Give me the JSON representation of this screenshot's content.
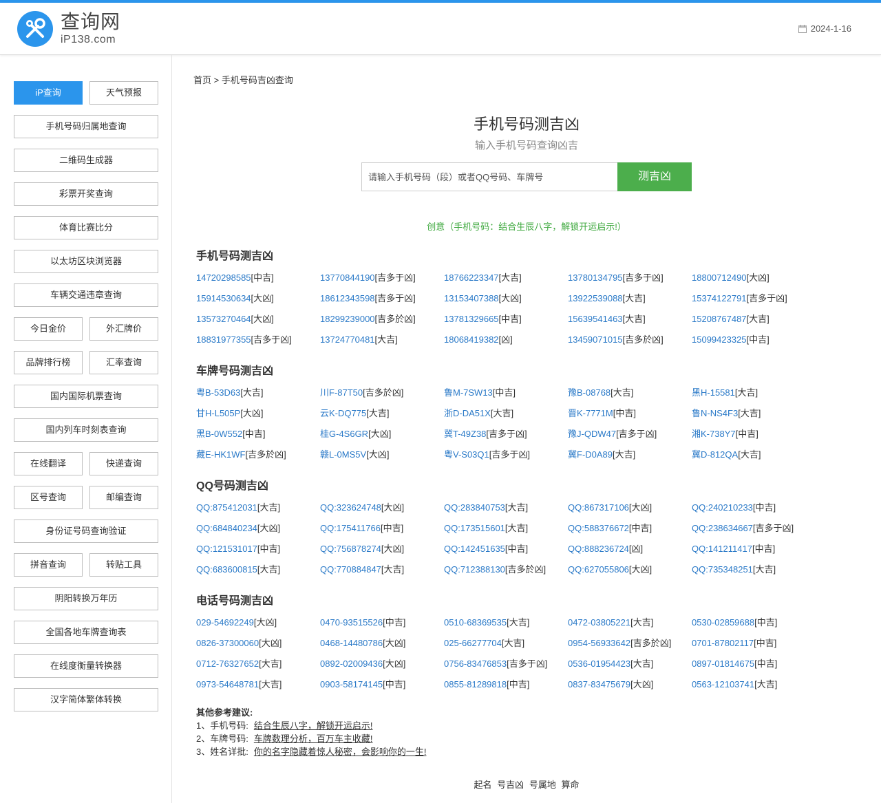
{
  "header": {
    "brand_cn": "查询网",
    "brand_en": "iP138.com",
    "date": "2024-1-16",
    "accent_color": "#2b95ec"
  },
  "sidebar": {
    "rows": [
      {
        "type": "pair",
        "items": [
          {
            "label": "iP查询",
            "active": true
          },
          {
            "label": "天气预报"
          }
        ]
      },
      {
        "type": "full",
        "items": [
          {
            "label": "手机号码归属地查询"
          }
        ]
      },
      {
        "type": "full",
        "items": [
          {
            "label": "二维码生成器"
          }
        ]
      },
      {
        "type": "full",
        "items": [
          {
            "label": "彩票开奖查询"
          }
        ]
      },
      {
        "type": "full",
        "items": [
          {
            "label": "体育比赛比分"
          }
        ]
      },
      {
        "type": "full",
        "items": [
          {
            "label": "以太坊区块浏览器"
          }
        ]
      },
      {
        "type": "full",
        "items": [
          {
            "label": "车辆交通违章查询"
          }
        ]
      },
      {
        "type": "pair",
        "items": [
          {
            "label": "今日金价"
          },
          {
            "label": "外汇牌价"
          }
        ]
      },
      {
        "type": "pair",
        "items": [
          {
            "label": "品牌排行榜"
          },
          {
            "label": "汇率查询"
          }
        ]
      },
      {
        "type": "full",
        "items": [
          {
            "label": "国内国际机票查询"
          }
        ]
      },
      {
        "type": "full",
        "items": [
          {
            "label": "国内列车时刻表查询"
          }
        ]
      },
      {
        "type": "pair",
        "items": [
          {
            "label": "在线翻译"
          },
          {
            "label": "快递查询"
          }
        ]
      },
      {
        "type": "pair",
        "items": [
          {
            "label": "区号查询"
          },
          {
            "label": "邮编查询"
          }
        ]
      },
      {
        "type": "full",
        "items": [
          {
            "label": "身份证号码查询验证"
          }
        ]
      },
      {
        "type": "pair",
        "items": [
          {
            "label": "拼音查询"
          },
          {
            "label": "转贴工具"
          }
        ]
      },
      {
        "type": "full",
        "items": [
          {
            "label": "阴阳转换万年历"
          }
        ]
      },
      {
        "type": "full",
        "items": [
          {
            "label": "全国各地车牌查询表"
          }
        ]
      },
      {
        "type": "full",
        "items": [
          {
            "label": "在线度衡量转换器"
          }
        ]
      },
      {
        "type": "full",
        "items": [
          {
            "label": "汉字简体繁体转换"
          }
        ]
      }
    ]
  },
  "breadcrumb": {
    "home": "首页",
    "sep": ">",
    "current": "手机号码吉凶查询"
  },
  "main": {
    "title": "手机号码测吉凶",
    "subtitle": "输入手机号码查询凶吉",
    "search_placeholder": "请输入手机号码（段）或者QQ号码、车牌号",
    "search_button": "测吉凶",
    "promo": "创意（手机号码：结合生辰八字，解锁开运启示!）"
  },
  "sections": [
    {
      "title": "手机号码测吉凶",
      "items": [
        {
          "n": "14720298585",
          "r": "[中吉]"
        },
        {
          "n": "13770844190",
          "r": "[吉多于凶]"
        },
        {
          "n": "18766223347",
          "r": "[大吉]"
        },
        {
          "n": "13780134795",
          "r": "[吉多于凶]"
        },
        {
          "n": "18800712490",
          "r": "[大凶]"
        },
        {
          "n": "15914530634",
          "r": "[大凶]"
        },
        {
          "n": "18612343598",
          "r": "[吉多于凶]"
        },
        {
          "n": "13153407388",
          "r": "[大凶]"
        },
        {
          "n": "13922539088",
          "r": "[大吉]"
        },
        {
          "n": "15374122791",
          "r": "[吉多于凶]"
        },
        {
          "n": "13573270464",
          "r": "[大凶]"
        },
        {
          "n": "18299239000",
          "r": "[吉多於凶]"
        },
        {
          "n": "13781329665",
          "r": "[中吉]"
        },
        {
          "n": "15639541463",
          "r": "[大吉]"
        },
        {
          "n": "15208767487",
          "r": "[大吉]"
        },
        {
          "n": "18831977355",
          "r": "[吉多于凶]"
        },
        {
          "n": "13724770481",
          "r": "[大吉]"
        },
        {
          "n": "18068419382",
          "r": "[凶]"
        },
        {
          "n": "13459071015",
          "r": "[吉多於凶]"
        },
        {
          "n": "15099423325",
          "r": "[中吉]"
        }
      ]
    },
    {
      "title": "车牌号码测吉凶",
      "items": [
        {
          "n": "粤B-53D63",
          "r": "[大吉]"
        },
        {
          "n": "川F-87T50",
          "r": "[吉多於凶]"
        },
        {
          "n": "鲁M-7SW13",
          "r": "[中吉]"
        },
        {
          "n": "豫B-08768",
          "r": "[大吉]"
        },
        {
          "n": "黑H-15581",
          "r": "[大吉]"
        },
        {
          "n": "甘H-L505P",
          "r": "[大凶]"
        },
        {
          "n": "云K-DQ775",
          "r": "[大吉]"
        },
        {
          "n": "浙D-DA51X",
          "r": "[大吉]"
        },
        {
          "n": "晋K-7771M",
          "r": "[中吉]"
        },
        {
          "n": "鲁N-NS4F3",
          "r": "[大吉]"
        },
        {
          "n": "黑B-0W552",
          "r": "[中吉]"
        },
        {
          "n": "桂G-4S6GR",
          "r": "[大凶]"
        },
        {
          "n": "冀T-49Z38",
          "r": "[吉多于凶]"
        },
        {
          "n": "豫J-QDW47",
          "r": "[吉多于凶]"
        },
        {
          "n": "湘K-738Y7",
          "r": "[中吉]"
        },
        {
          "n": "藏E-HK1WF",
          "r": "[吉多於凶]"
        },
        {
          "n": "赣L-0MS5V",
          "r": "[大凶]"
        },
        {
          "n": "粤V-S03Q1",
          "r": "[吉多于凶]"
        },
        {
          "n": "冀F-D0A89",
          "r": "[大吉]"
        },
        {
          "n": "冀D-812QA",
          "r": "[大吉]"
        }
      ]
    },
    {
      "title": "QQ号码测吉凶",
      "items": [
        {
          "n": "QQ:875412031",
          "r": "[大吉]"
        },
        {
          "n": "QQ:323624748",
          "r": "[大凶]"
        },
        {
          "n": "QQ:283840753",
          "r": "[大吉]"
        },
        {
          "n": "QQ:867317106",
          "r": "[大凶]"
        },
        {
          "n": "QQ:240210233",
          "r": "[中吉]"
        },
        {
          "n": "QQ:684840234",
          "r": "[大凶]"
        },
        {
          "n": "QQ:175411766",
          "r": "[中吉]"
        },
        {
          "n": "QQ:173515601",
          "r": "[大吉]"
        },
        {
          "n": "QQ:588376672",
          "r": "[中吉]"
        },
        {
          "n": "QQ:238634667",
          "r": "[吉多于凶]"
        },
        {
          "n": "QQ:121531017",
          "r": "[中吉]"
        },
        {
          "n": "QQ:756878274",
          "r": "[大凶]"
        },
        {
          "n": "QQ:142451635",
          "r": "[中吉]"
        },
        {
          "n": "QQ:888236724",
          "r": "[凶]"
        },
        {
          "n": "QQ:141211417",
          "r": "[中吉]"
        },
        {
          "n": "QQ:683600815",
          "r": "[大吉]"
        },
        {
          "n": "QQ:770884847",
          "r": "[大吉]"
        },
        {
          "n": "QQ:712388130",
          "r": "[吉多於凶]"
        },
        {
          "n": "QQ:627055806",
          "r": "[大凶]"
        },
        {
          "n": "QQ:735348251",
          "r": "[大吉]"
        }
      ]
    },
    {
      "title": "电话号码测吉凶",
      "items": [
        {
          "n": "029-54692249",
          "r": "[大凶]"
        },
        {
          "n": "0470-93515526",
          "r": "[中吉]"
        },
        {
          "n": "0510-68369535",
          "r": "[大吉]"
        },
        {
          "n": "0472-03805221",
          "r": "[大吉]"
        },
        {
          "n": "0530-02859688",
          "r": "[中吉]"
        },
        {
          "n": "0826-37300060",
          "r": "[大凶]"
        },
        {
          "n": "0468-14480786",
          "r": "[大凶]"
        },
        {
          "n": "025-66277704",
          "r": "[大吉]"
        },
        {
          "n": "0954-56933642",
          "r": "[吉多於凶]"
        },
        {
          "n": "0701-87802117",
          "r": "[中吉]"
        },
        {
          "n": "0712-76327652",
          "r": "[大吉]"
        },
        {
          "n": "0892-02009436",
          "r": "[大凶]"
        },
        {
          "n": "0756-83476853",
          "r": "[吉多于凶]"
        },
        {
          "n": "0536-01954423",
          "r": "[大吉]"
        },
        {
          "n": "0897-01814675",
          "r": "[中吉]"
        },
        {
          "n": "0973-54648781",
          "r": "[大吉]"
        },
        {
          "n": "0903-58174145",
          "r": "[中吉]"
        },
        {
          "n": "0855-81289818",
          "r": "[中吉]"
        },
        {
          "n": "0837-83475679",
          "r": "[大凶]"
        },
        {
          "n": "0563-12103741",
          "r": "[大吉]"
        }
      ]
    }
  ],
  "refs": {
    "title": "其他参考建议:",
    "lines": [
      {
        "prefix": "1、手机号码:",
        "link": "结合生辰八字，解锁开运启示!"
      },
      {
        "prefix": "2、车牌号码:",
        "link": "车牌数理分析，百万车主收藏!"
      },
      {
        "prefix": "3、姓名详批:",
        "link": "你的名字隐藏着惊人秘密，会影响你的一生!"
      }
    ]
  },
  "footer": {
    "links": [
      "起名",
      "号吉凶",
      "号属地",
      "算命"
    ]
  }
}
